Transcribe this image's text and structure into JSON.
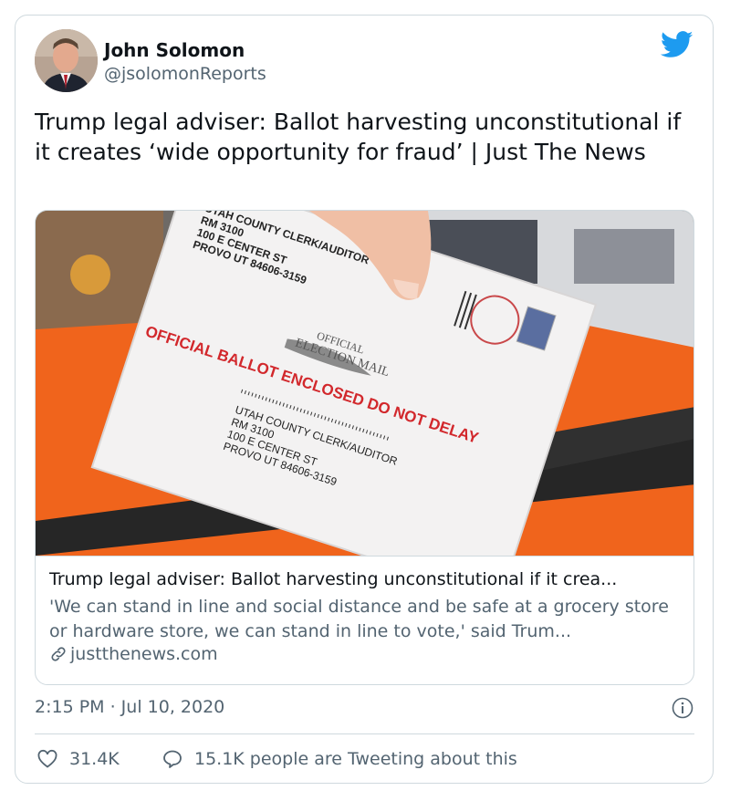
{
  "author": {
    "name": "John Solomon",
    "handle": "@jsolomonReports"
  },
  "tweet": {
    "text": "Trump legal adviser: Ballot harvesting unconstitutional if it creates ‘wide opportunity for fraud’ | Just The News",
    "timestamp": "2:15 PM · Jul 10, 2020"
  },
  "link_card": {
    "title": "Trump legal adviser: Ballot harvesting unconstitutional if it crea...",
    "description": "'We can stand in line and social distance and be safe at a grocery store or hardware store, we can stand in line to vote,' said Trum...",
    "domain": "justthenews.com",
    "image": {
      "address_top": [
        "UTAH COUNTY CLERK/AUDITOR",
        "RM 3100",
        "100 E CENTER ST",
        "PROVO UT 84606-3159"
      ],
      "stamp_line1": "OFFICIAL",
      "stamp_line2": "ELECTION MAIL",
      "ballot_line": "OFFICIAL BALLOT ENCLOSED DO NOT DELAY",
      "address_bottom": [
        "UTAH COUNTY CLERK/AUDITOR",
        "RM 3100",
        "100 E CENTER ST",
        "PROVO UT 84606-3159"
      ]
    }
  },
  "actions": {
    "likes": "31.4K",
    "tweeting": "15.1K people are Tweeting about this"
  },
  "colors": {
    "twitter_blue": "#1d9bf0",
    "text_primary": "#0f1419",
    "text_secondary": "#536471",
    "border": "#cfd9de",
    "ballot_red": "#d2282c",
    "bag_orange": "#f0641c"
  },
  "icons": {
    "brand": "twitter-bird-icon",
    "info": "info-icon",
    "link": "link-icon",
    "like": "heart-icon",
    "reply": "speech-bubble-icon"
  }
}
